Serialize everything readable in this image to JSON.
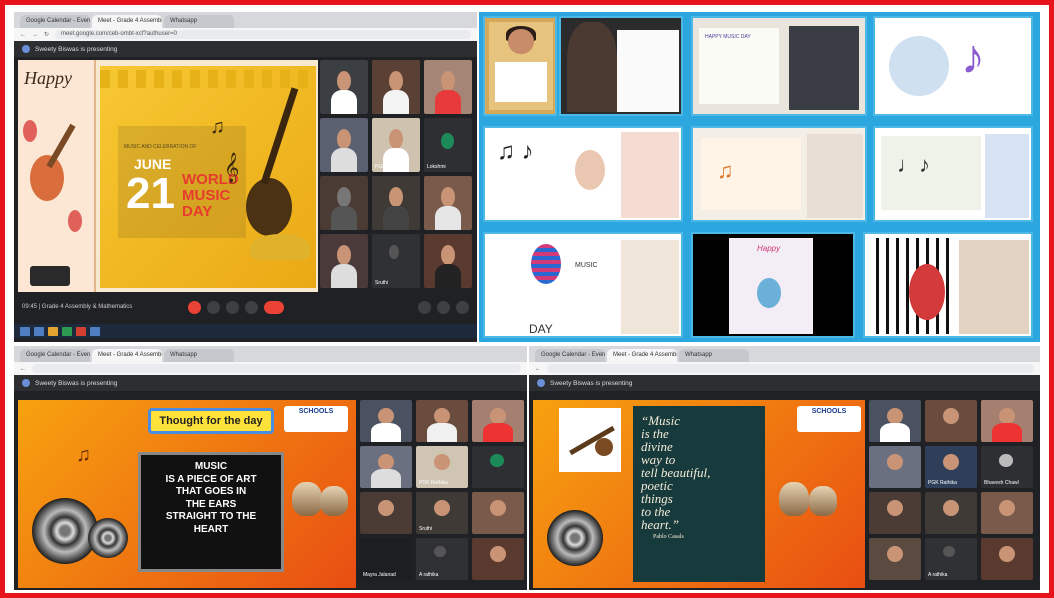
{
  "top_left": {
    "tabs": [
      "Google Calendar - Event details",
      "Meet - Grade 4 Assembly &",
      "Whatsapp"
    ],
    "url": "meet.google.com/ceb-ombt-xcf?authuser=0",
    "presenting": "Sweety Biswas is presenting",
    "bottom_title": "09:45  |  Grade 4 Assembly & Mathematics",
    "poster": {
      "happy": "Happy",
      "date_num": "21",
      "month": "JUNE",
      "line1": "WORLD",
      "line2": "MUSIC",
      "line3": "DAY",
      "small": "MUSIC AND CELEBRATION OF"
    },
    "participants": [
      "",
      "",
      "",
      "",
      "",
      "",
      "PGK Rathika",
      "Lokshmi",
      "",
      "",
      "",
      "",
      "Sruthi",
      "",
      "",
      ""
    ]
  },
  "drawings": {
    "cells": [
      "kid-holding-drawing",
      "kid-holding-drawing",
      "happy-music-day",
      "music-note-drawing",
      "instruments-drawing",
      "music-day-drawing",
      "notes-collage",
      "music-day-poster",
      "guitar-drawing",
      "piano-guitar-drawing"
    ],
    "labels": [
      "HAPPY MUSIC DAY",
      "MUSIC",
      "DAY",
      "Happy"
    ]
  },
  "bottom_left": {
    "tabs": [
      "Google Calendar - Event details",
      "Meet - Grade 4 Assembly &",
      "Whatsapp"
    ],
    "presenting": "Sweety Biswas is presenting",
    "thought": "Thought  for the day",
    "logo": "SCHOOLS",
    "message": [
      "MUSIC",
      "IS A PIECE OF ART",
      "THAT GOES IN",
      "THE EARS",
      "STRAIGHT TO THE",
      "HEART"
    ],
    "participants": [
      "",
      "",
      "",
      "",
      "",
      "",
      "PGK Rathika",
      "",
      "",
      "",
      "Sruthi",
      "",
      "",
      "Mayra Jalanad",
      "A rathika",
      ""
    ]
  },
  "bottom_right": {
    "tabs": [
      "Google Calendar - Event details",
      "Meet - Grade 4 Assembly &",
      "Whatsapp"
    ],
    "presenting": "Sweety Biswas is presenting",
    "logo": "SCHOOLS",
    "quote": [
      "“Music",
      "is the",
      "divine",
      "way to",
      "tell beautiful,",
      "poetic",
      "things",
      "to the",
      "heart.”"
    ],
    "author": "Pablo Casals",
    "participants": [
      "",
      "",
      "",
      "",
      "PGK Rathika",
      "Bhavesh Chawl",
      "",
      "",
      "",
      "",
      "",
      "A rathika",
      "",
      ""
    ]
  },
  "colors": {
    "frame": "#e8141b",
    "accent_blue": "#2ba6de",
    "meet_bg": "#1f2124"
  }
}
